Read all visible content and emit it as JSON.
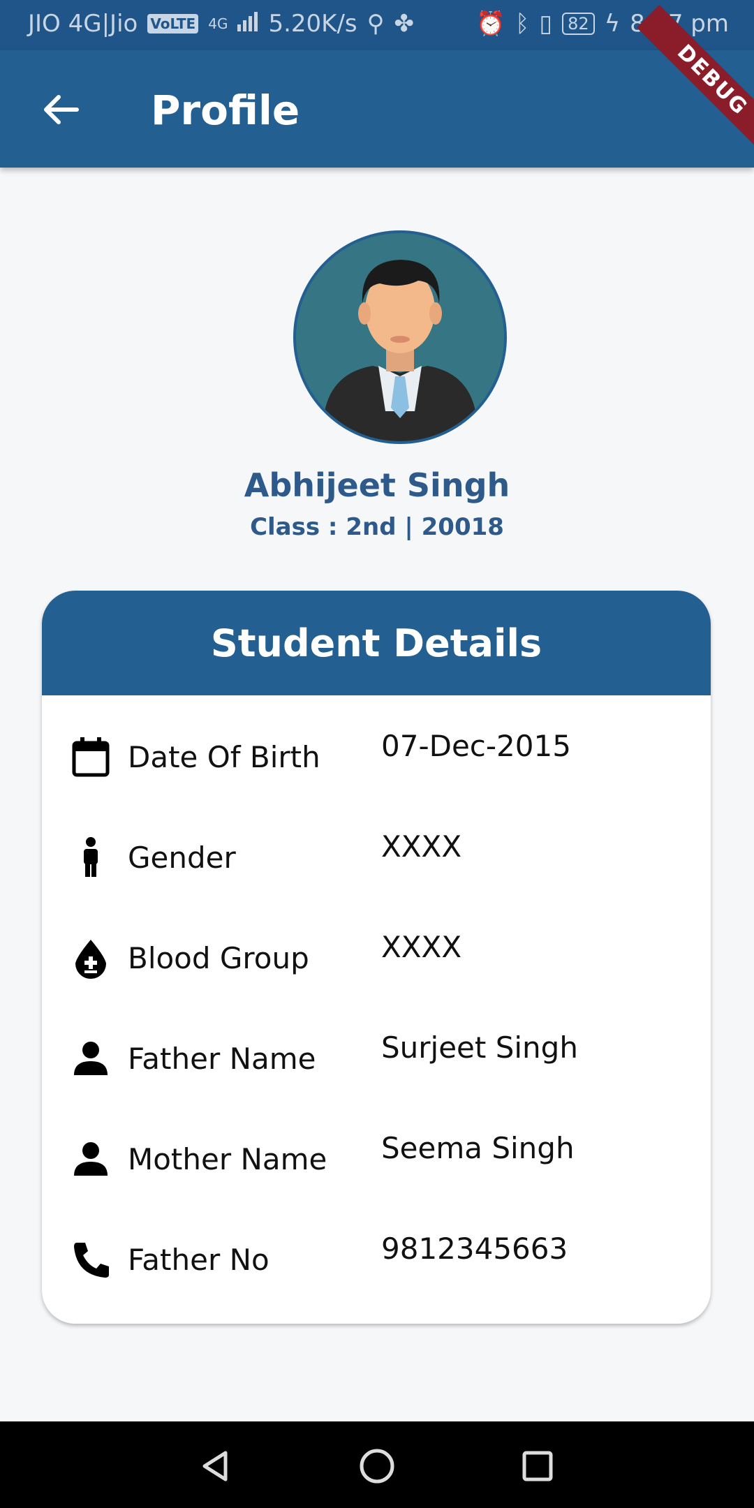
{
  "status_bar": {
    "carrier": "JIO 4G|Jio",
    "volte": "VoLTE",
    "network": "4G",
    "speed": "5.20K/s",
    "battery": "82",
    "time": "8:37 pm"
  },
  "app_bar": {
    "title": "Profile",
    "debug_label": "DEBUG"
  },
  "profile": {
    "name": "Abhijeet Singh",
    "class_info": "Class : 2nd  | 20018"
  },
  "details_card": {
    "header": "Student Details",
    "rows": [
      {
        "icon": "calendar-icon",
        "label": "Date Of Birth",
        "value": "07-Dec-2015"
      },
      {
        "icon": "person-standing-icon",
        "label": "Gender",
        "value": "XXXX"
      },
      {
        "icon": "blood-drop-icon",
        "label": "Blood Group",
        "value": "XXXX"
      },
      {
        "icon": "person-icon",
        "label": "Father Name",
        "value": "Surjeet Singh"
      },
      {
        "icon": "person-icon",
        "label": "Mother Name",
        "value": "Seema Singh"
      },
      {
        "icon": "phone-icon",
        "label": "Father No",
        "value": "9812345663"
      }
    ]
  },
  "colors": {
    "primary": "#245f92",
    "status_bar": "#1f5588",
    "background": "#f6f7f9"
  }
}
